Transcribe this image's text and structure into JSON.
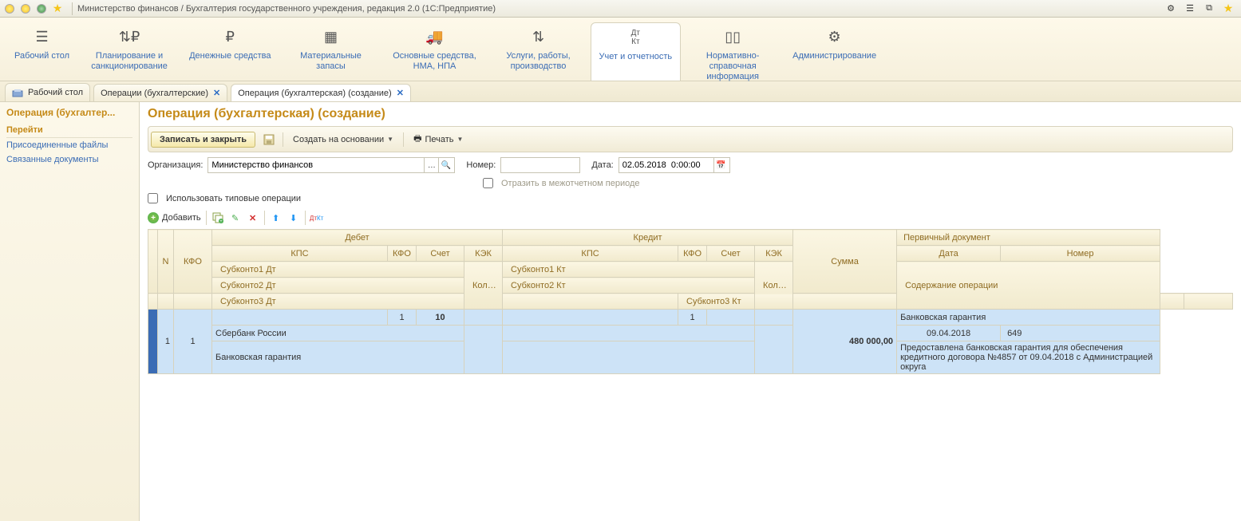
{
  "titlebar": {
    "title": "Министерство финансов / Бухгалтерия государственного учреждения, редакция 2.0  (1С:Предприятие)"
  },
  "sections": [
    {
      "label": "Рабочий стол"
    },
    {
      "label": "Планирование и санкционирование"
    },
    {
      "label": "Денежные средства"
    },
    {
      "label": "Материальные запасы"
    },
    {
      "label": "Основные средства, НМА, НПА"
    },
    {
      "label": "Услуги, работы, производство"
    },
    {
      "label": "Учет и отчетность"
    },
    {
      "label": "Нормативно-справочная информация"
    },
    {
      "label": "Администрирование"
    }
  ],
  "tabs": [
    {
      "label": "Рабочий стол"
    },
    {
      "label": "Операции (бухгалтерские)"
    },
    {
      "label": "Операция (бухгалтерская) (создание)"
    }
  ],
  "nav": {
    "title": "Операция (бухгалтер...",
    "heading": "Перейти",
    "links": [
      "Присоединенные файлы",
      "Связанные документы"
    ]
  },
  "page": {
    "title": "Операция (бухгалтерская) (создание)",
    "cmd": {
      "save": "Записать и закрыть",
      "create_based": "Создать на основании",
      "print": "Печать"
    },
    "form": {
      "org_label": "Организация:",
      "org_value": "Министерство финансов",
      "number_label": "Номер:",
      "number_value": "",
      "date_label": "Дата:",
      "date_value": "02.05.2018  0:00:00",
      "reflect_label": "Отразить в межотчетном периоде",
      "use_typical_label": "Использовать типовые операции"
    },
    "gridbar": {
      "add": "Добавить"
    },
    "headers": {
      "n": "N",
      "kfo": "КФО",
      "debit": "Дебет",
      "credit": "Кредит",
      "sum": "Сумма",
      "prim_doc": "Первичный документ",
      "kps": "КПС",
      "kfo2": "КФО",
      "acct": "Счет",
      "kek": "КЭК",
      "qty": "Количество",
      "date": "Дата",
      "number": "Номер",
      "sub1d": "Субконто1 Дт",
      "sub2d": "Субконто2 Дт",
      "sub3d": "Субконто3 Дт",
      "sub1k": "Субконто1 Кт",
      "sub2k": "Субконто2 Кт",
      "sub3k": "Субконто3 Кт",
      "content": "Содержание операции"
    },
    "row": {
      "n": "1",
      "kfo": "1",
      "kfo_d": "1",
      "acct_d": "10",
      "kfo_k": "1",
      "sum": "480 000,00",
      "prim_doc": "Банковская гарантия",
      "date": "09.04.2018",
      "number": "649",
      "sub1d": "Сбербанк России",
      "sub2d": "Банковская гарантия",
      "content": "Предоставлена банковская гарантия для обеспечения кредитного договора №4857 от 09.04.2018 с Администрацией округа"
    }
  }
}
